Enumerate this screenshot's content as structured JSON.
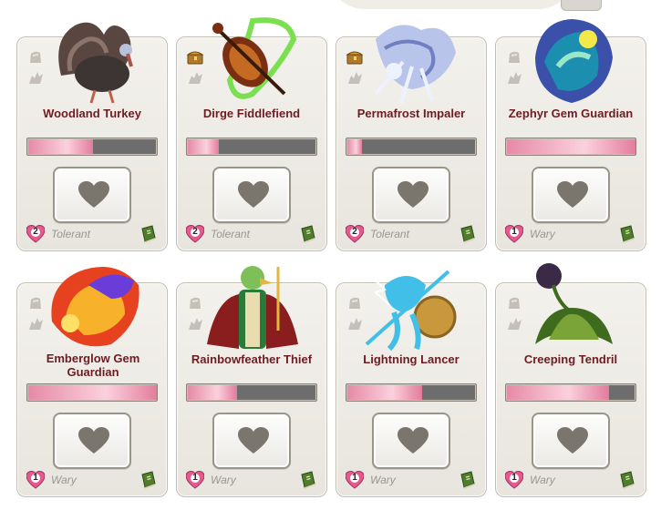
{
  "cards": [
    {
      "name": "Woodland Turkey",
      "level": "2",
      "mood": "Tolerant",
      "affection": 0.5,
      "chest": false,
      "art": {
        "kind": "turkey",
        "colors": [
          "#5a4640",
          "#a8554a",
          "#3d3533"
        ]
      }
    },
    {
      "name": "Dirge Fiddlefiend",
      "level": "2",
      "mood": "Tolerant",
      "affection": 0.24,
      "chest": true,
      "art": {
        "kind": "fiddle",
        "colors": [
          "#7a2e12",
          "#c46a22",
          "#7be04f"
        ]
      }
    },
    {
      "name": "Permafrost Impaler",
      "level": "2",
      "mood": "Tolerant",
      "affection": 0.11,
      "chest": true,
      "art": {
        "kind": "ice",
        "colors": [
          "#b8c4ea",
          "#6f7fc2",
          "#eef2ff"
        ]
      }
    },
    {
      "name": "Zephyr Gem Guardian",
      "level": "1",
      "mood": "Wary",
      "affection": 1.0,
      "chest": false,
      "art": {
        "kind": "gem",
        "colors": [
          "#1c8fb0",
          "#3b50a8",
          "#9ae6c8"
        ]
      }
    },
    {
      "name": "Emberglow Gem Guardian",
      "level": "1",
      "mood": "Wary",
      "affection": 1.0,
      "chest": false,
      "art": {
        "kind": "flame",
        "colors": [
          "#e7421f",
          "#f7b12b",
          "#6a3dd8"
        ]
      }
    },
    {
      "name": "Rainbowfeather Thief",
      "level": "1",
      "mood": "Wary",
      "affection": 0.38,
      "chest": false,
      "art": {
        "kind": "bird",
        "colors": [
          "#8a1d1d",
          "#2a7a3a",
          "#e3b73b"
        ]
      }
    },
    {
      "name": "Lightning Lancer",
      "level": "1",
      "mood": "Wary",
      "affection": 0.58,
      "chest": false,
      "art": {
        "kind": "lancer",
        "colors": [
          "#42bfe8",
          "#c9983d",
          "#ffffff"
        ]
      }
    },
    {
      "name": "Creeping Tendril",
      "level": "1",
      "mood": "Wary",
      "affection": 0.79,
      "chest": false,
      "art": {
        "kind": "plant",
        "colors": [
          "#3f6b1f",
          "#7aa338",
          "#3b2a47"
        ]
      }
    }
  ],
  "colors": {
    "name": "#6e1c22",
    "mood": "#9a9790",
    "badge_pink": "#e55a8e"
  }
}
